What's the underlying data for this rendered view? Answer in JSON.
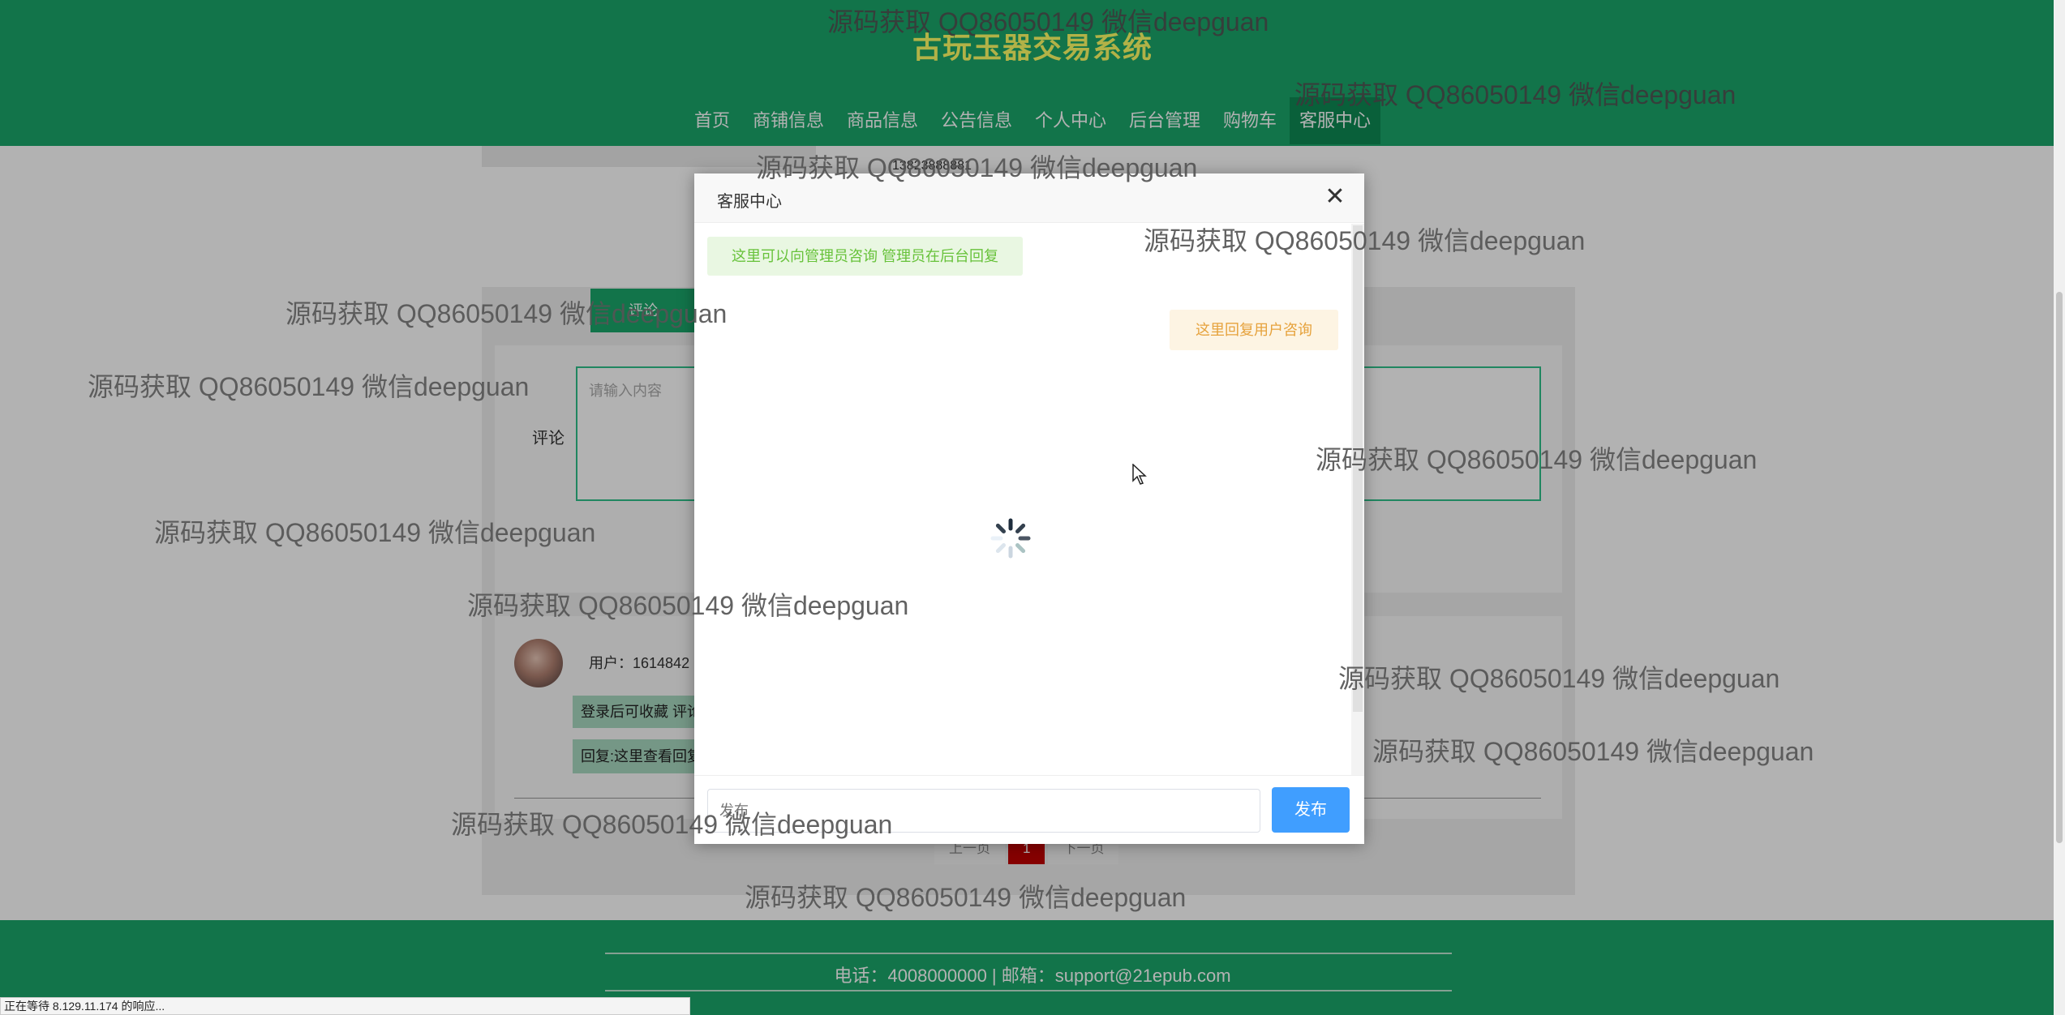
{
  "site": {
    "title": "古玩玉器交易系统",
    "nav": [
      "首页",
      "商铺信息",
      "商品信息",
      "公告信息",
      "个人中心",
      "后台管理",
      "购物车",
      "客服中心"
    ],
    "active_nav_index": 7
  },
  "background": {
    "shop_phone": "13823888881",
    "button_label": "评论",
    "comment_label": "评论",
    "comment_placeholder": "请输入内容",
    "review_user": "用户：1614842",
    "review_tag_1": "登录后可收藏 评论",
    "review_tag_2": "回复:这里查看回复",
    "pager": {
      "prev": "上一页",
      "current": "1",
      "next": "下一页"
    }
  },
  "modal": {
    "title": "客服中心",
    "close_glyph": "✕",
    "messages": [
      {
        "side": "left",
        "text": "这里可以向管理员咨询 管理员在后台回复",
        "color": "#67c23a"
      },
      {
        "side": "right",
        "text": "这里回复用户咨询",
        "color": "#e6a23c"
      }
    ],
    "input_placeholder": "发布",
    "send_label": "发布",
    "loading": true
  },
  "footer": {
    "text": "电话：4008000000 | 邮箱：support@21epub.com"
  },
  "status_bar": "正在等待 8.129.11.174 的响应...",
  "watermark_text": "源码获取 QQ86050149 微信deepguan",
  "colors": {
    "brand_green": "#1aa66a",
    "title_yellow": "#ffff66",
    "send_blue": "#409eff",
    "pager_red": "#c00000"
  },
  "icons": {
    "close": "close-icon",
    "spinner": "loading-spinner-icon",
    "cursor": "mouse-cursor-icon"
  }
}
